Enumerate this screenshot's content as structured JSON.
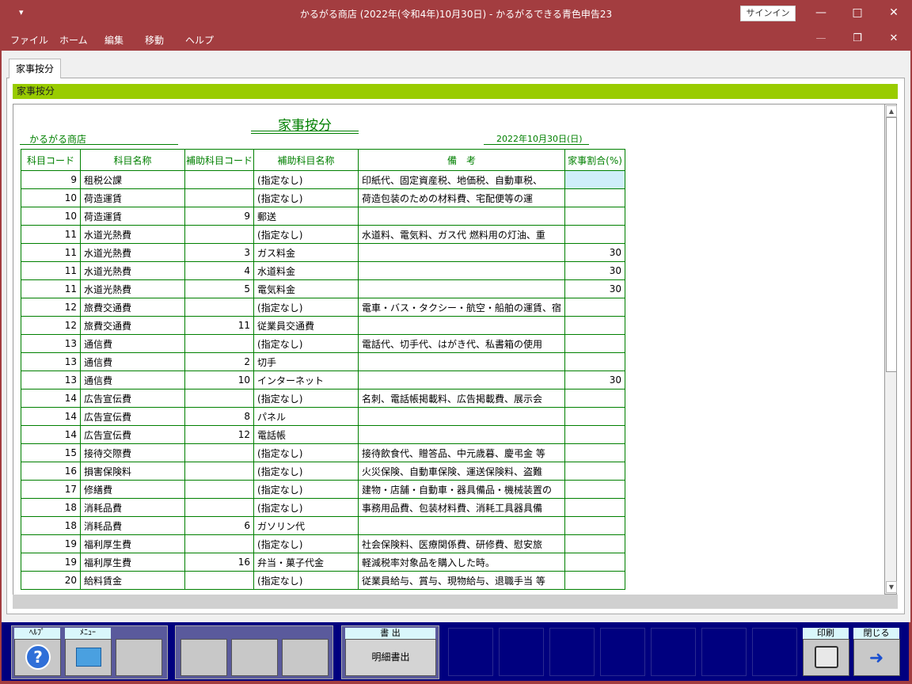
{
  "window": {
    "title": "かるがる商店 (2022年(令和4年)10月30日) - かるがるできる青色申告23",
    "signin_label": "サインイン",
    "quick_access": "▾"
  },
  "menu": {
    "file": "ファイル",
    "home": "ホーム",
    "edit": "編集",
    "move": "移動",
    "help": "ヘルプ"
  },
  "tab": {
    "label": "家事按分"
  },
  "section_title": "家事按分",
  "report": {
    "title": "家事按分",
    "shop_name": "かるがる商店",
    "date": "2022年10月30日(日)",
    "columns": [
      "科目コード",
      "科目名称",
      "補助科目コード",
      "補助科目名称",
      "備　考",
      "家事割合(%)"
    ],
    "rows": [
      {
        "code": "9",
        "name": "租税公課",
        "sub_code": "",
        "sub_name": "(指定なし)",
        "note": "印紙代、固定資産税、地価税、自動車税、",
        "pct": ""
      },
      {
        "code": "10",
        "name": "荷造運賃",
        "sub_code": "",
        "sub_name": "(指定なし)",
        "note": "荷造包装のための材料費、宅配便等の運",
        "pct": ""
      },
      {
        "code": "10",
        "name": "荷造運賃",
        "sub_code": "9",
        "sub_name": "郵送",
        "note": "",
        "pct": ""
      },
      {
        "code": "11",
        "name": "水道光熱費",
        "sub_code": "",
        "sub_name": "(指定なし)",
        "note": "水道料、電気料、ガス代 燃料用の灯油、重",
        "pct": ""
      },
      {
        "code": "11",
        "name": "水道光熱費",
        "sub_code": "3",
        "sub_name": "ガス料金",
        "note": "",
        "pct": "30"
      },
      {
        "code": "11",
        "name": "水道光熱費",
        "sub_code": "4",
        "sub_name": "水道料金",
        "note": "",
        "pct": "30"
      },
      {
        "code": "11",
        "name": "水道光熱費",
        "sub_code": "5",
        "sub_name": "電気料金",
        "note": "",
        "pct": "30"
      },
      {
        "code": "12",
        "name": "旅費交通費",
        "sub_code": "",
        "sub_name": "(指定なし)",
        "note": "電車・バス・タクシー・航空・船舶の運賃、宿",
        "pct": ""
      },
      {
        "code": "12",
        "name": "旅費交通費",
        "sub_code": "11",
        "sub_name": "従業員交通費",
        "note": "",
        "pct": ""
      },
      {
        "code": "13",
        "name": "通信費",
        "sub_code": "",
        "sub_name": "(指定なし)",
        "note": "電話代、切手代、はがき代、私書箱の使用",
        "pct": ""
      },
      {
        "code": "13",
        "name": "通信費",
        "sub_code": "2",
        "sub_name": "切手",
        "note": "",
        "pct": ""
      },
      {
        "code": "13",
        "name": "通信費",
        "sub_code": "10",
        "sub_name": "インターネット",
        "note": "",
        "pct": "30"
      },
      {
        "code": "14",
        "name": "広告宣伝費",
        "sub_code": "",
        "sub_name": "(指定なし)",
        "note": "名刺、電話帳掲載料、広告掲載費、展示会",
        "pct": ""
      },
      {
        "code": "14",
        "name": "広告宣伝費",
        "sub_code": "8",
        "sub_name": "パネル",
        "note": "",
        "pct": ""
      },
      {
        "code": "14",
        "name": "広告宣伝費",
        "sub_code": "12",
        "sub_name": "電話帳",
        "note": "",
        "pct": ""
      },
      {
        "code": "15",
        "name": "接待交際費",
        "sub_code": "",
        "sub_name": "(指定なし)",
        "note": "接待飲食代、贈答品、中元歳暮、慶弔金 等",
        "pct": ""
      },
      {
        "code": "16",
        "name": "損害保険料",
        "sub_code": "",
        "sub_name": "(指定なし)",
        "note": "火災保険、自動車保険、運送保険料、盗難",
        "pct": ""
      },
      {
        "code": "17",
        "name": "修繕費",
        "sub_code": "",
        "sub_name": "(指定なし)",
        "note": "建物・店舗・自動車・器具備品・機械装置の",
        "pct": ""
      },
      {
        "code": "18",
        "name": "消耗品費",
        "sub_code": "",
        "sub_name": "(指定なし)",
        "note": "事務用品費、包装材料費、消耗工具器具備",
        "pct": ""
      },
      {
        "code": "18",
        "name": "消耗品費",
        "sub_code": "6",
        "sub_name": "ガソリン代",
        "note": "",
        "pct": ""
      },
      {
        "code": "19",
        "name": "福利厚生費",
        "sub_code": "",
        "sub_name": "(指定なし)",
        "note": "社会保険料、医療関係費、研修費、慰安旅",
        "pct": ""
      },
      {
        "code": "19",
        "name": "福利厚生費",
        "sub_code": "16",
        "sub_name": "弁当・菓子代金",
        "note": "軽減税率対象品を購入した時。",
        "pct": ""
      },
      {
        "code": "20",
        "name": "給料賃金",
        "sub_code": "",
        "sub_name": "(指定なし)",
        "note": "従業員給与、賞与、現物給与、退職手当 等",
        "pct": ""
      }
    ]
  },
  "toolbar": {
    "help_label": "ﾍﾙﾌﾟ",
    "menu_label": "ﾒﾆｭｰ",
    "output_label": "書 出",
    "output_button": "明細書出",
    "print_label": "印刷",
    "close_label": "閉じる"
  },
  "colors": {
    "titlebar": "#a33d40",
    "accent_green": "#99cc00",
    "report_green": "#008000",
    "toolbar": "#00007f"
  }
}
